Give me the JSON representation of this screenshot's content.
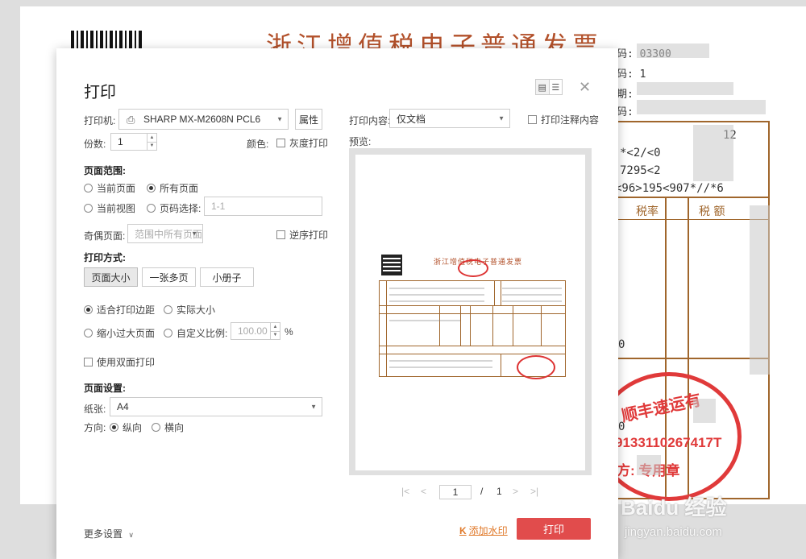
{
  "background": {
    "invoice_title": "浙江增值税电子普通发票",
    "code_lines": [
      "码: 03300",
      "码: 1",
      "期:",
      "码:"
    ],
    "cipher_lines": [
      "12",
      "*<2/<0",
      "7295<2",
      "<96>195<907*//*6"
    ],
    "col_headers": [
      "税率",
      "税  额"
    ],
    "seal_line1": "顺丰速运有",
    "seal_line2": "9133110267417T",
    "seal_line3": "方:    专用章",
    "watermark_main": "Baidu 经验",
    "watermark_sub": "jingyan.baidu.com"
  },
  "dialog": {
    "title": "打印",
    "printer_label": "打印机:",
    "printer_value": "SHARP MX-M2608N PCL6",
    "properties_button": "属性",
    "copies_label": "份数:",
    "copies_value": "1",
    "color_label": "颜色:",
    "grayscale_label": "灰度打印",
    "page_range_label": "页面范围:",
    "range_current_page": "当前页面",
    "range_all_pages": "所有页面",
    "range_current_view": "当前视图",
    "range_page_select": "页码选择:",
    "page_select_placeholder": "1-1",
    "odd_even_label": "奇偶页面:",
    "odd_even_value": "范围中所有页面",
    "reverse_label": "逆序打印",
    "print_mode_label": "打印方式:",
    "mode_buttons": [
      "页面大小",
      "一张多页",
      "小册子"
    ],
    "fit_margins": "适合打印边距",
    "actual_size": "实际大小",
    "shrink_large": "缩小过大页面",
    "custom_scale": "自定义比例:",
    "scale_value": "100.00",
    "scale_unit": "%",
    "duplex_label": "使用双面打印",
    "page_setup_label": "页面设置:",
    "paper_label": "纸张:",
    "paper_value": "A4",
    "orientation_label": "方向:",
    "portrait": "纵向",
    "landscape": "横向",
    "print_content_label": "打印内容:",
    "print_content_value": "仅文档",
    "print_annotations": "打印注释内容",
    "preview_label": "预览:",
    "preview_invoice_title": "浙江增值税电子普通发票",
    "pager_current": "1",
    "pager_separator": "/",
    "pager_total": "1",
    "more_settings": "更多设置",
    "add_watermark": "添加水印",
    "print_button": "打印"
  },
  "colors": {
    "accent": "#e14c4c",
    "invoice_brown": "#a0662c",
    "seal_red": "#e03a3a",
    "watermark_link": "#e0792a"
  }
}
